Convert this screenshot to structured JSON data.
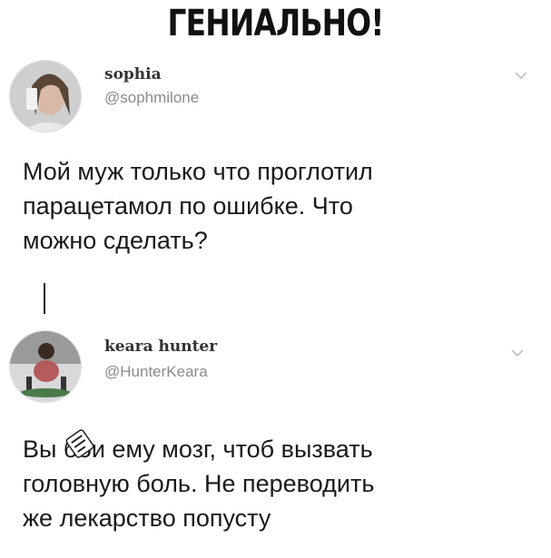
{
  "banner": {
    "title": "ГЕНИАЛЬНО!"
  },
  "tweet1": {
    "name": "sophia",
    "handle": "@sophmilone",
    "text": "Мой муж только что проглотил\nпарацетамол по ошибке. Что\nможно сделать?"
  },
  "tweet2": {
    "name": "keara hunter",
    "handle": "@HunterKeara",
    "text": "Вы бби ему мозг, чтоб вызвать\nголовную боль. Не переводить\nже лекарство попусту"
  },
  "icons": {
    "chevron": "chevron-down-icon",
    "stamp": "watermark-stamp-icon"
  },
  "colors": {
    "handle": "#8a8a8a",
    "text": "#1a1a1a",
    "chevron": "#b8b8b8"
  }
}
